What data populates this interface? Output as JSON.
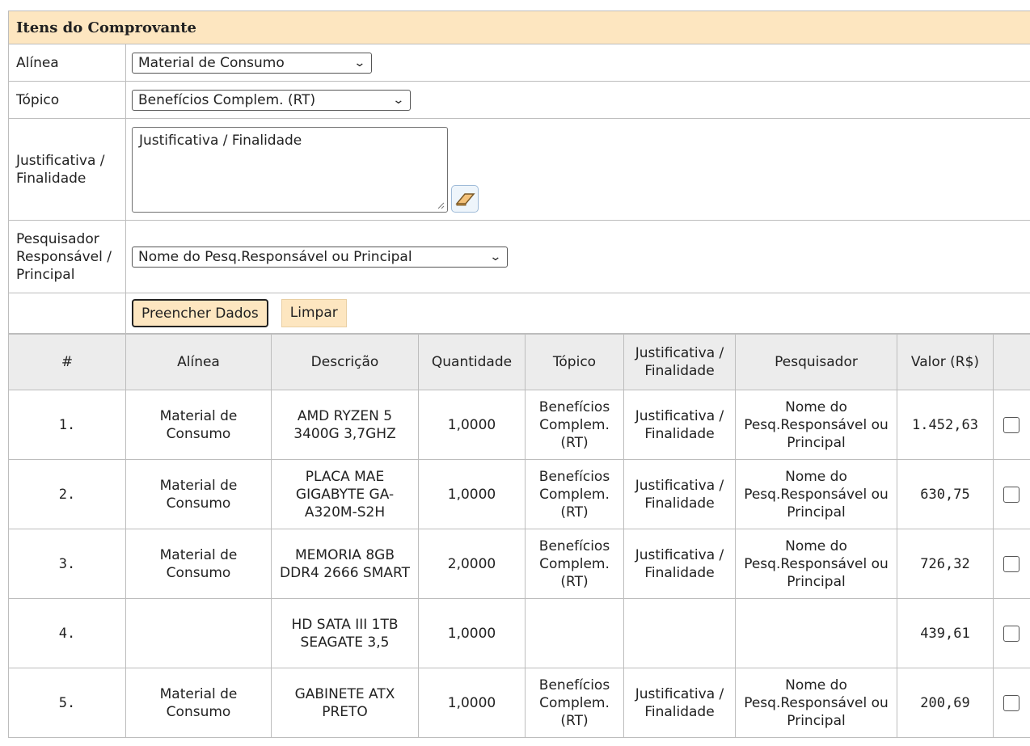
{
  "section_title": "Itens do Comprovante",
  "form": {
    "alinea": {
      "label": "Alínea",
      "value": "Material de Consumo"
    },
    "topico": {
      "label": "Tópico",
      "value": "Benefícios Complem. (RT)"
    },
    "justificativa": {
      "label": "Justificativa / Finalidade",
      "placeholder": "Justificativa / Finalidade"
    },
    "pesquisador": {
      "label": "Pesquisador Responsável / Principal",
      "value": "Nome do Pesq.Responsável ou Principal"
    },
    "buttons": {
      "fill": "Preencher Dados",
      "clear": "Limpar"
    }
  },
  "table": {
    "headers": [
      "#",
      "Alínea",
      "Descrição",
      "Quantidade",
      "Tópico",
      "Justificativa / Finalidade",
      "Pesquisador",
      "Valor (R$)",
      ""
    ],
    "rows": [
      {
        "num": "1.",
        "alinea": "Material de Consumo",
        "descricao": "AMD RYZEN 5 3400G 3,7GHZ",
        "quantidade": "1,0000",
        "topico": "Benefícios Complem. (RT)",
        "justificativa": "Justificativa / Finalidade",
        "pesquisador": "Nome do Pesq.Responsável ou Principal",
        "valor": "1.452,63",
        "checked": false
      },
      {
        "num": "2.",
        "alinea": "Material de Consumo",
        "descricao": "PLACA MAE GIGABYTE GA-A320M-S2H",
        "quantidade": "1,0000",
        "topico": "Benefícios Complem. (RT)",
        "justificativa": "Justificativa / Finalidade",
        "pesquisador": "Nome do Pesq.Responsável ou Principal",
        "valor": "630,75",
        "checked": false
      },
      {
        "num": "3.",
        "alinea": "Material de Consumo",
        "descricao": "MEMORIA 8GB DDR4 2666 SMART",
        "quantidade": "2,0000",
        "topico": "Benefícios Complem. (RT)",
        "justificativa": "Justificativa / Finalidade",
        "pesquisador": "Nome do Pesq.Responsável ou Principal",
        "valor": "726,32",
        "checked": false
      },
      {
        "num": "4.",
        "alinea": "",
        "descricao": "HD SATA III 1TB SEAGATE 3,5",
        "quantidade": "1,0000",
        "topico": "",
        "justificativa": "",
        "pesquisador": "",
        "valor": "439,61",
        "checked": false
      },
      {
        "num": "5.",
        "alinea": "Material de Consumo",
        "descricao": "GABINETE ATX PRETO",
        "quantidade": "1,0000",
        "topico": "Benefícios Complem. (RT)",
        "justificativa": "Justificativa / Finalidade",
        "pesquisador": "Nome do Pesq.Responsável ou Principal",
        "valor": "200,69",
        "checked": false
      }
    ]
  },
  "icons": {
    "eraser": "eraser-icon",
    "select_arrow": "chevron-down-icon"
  },
  "colors": {
    "header_bg": "#fde6c0",
    "table_header_bg": "#ececec",
    "border": "#bdbdbd"
  }
}
